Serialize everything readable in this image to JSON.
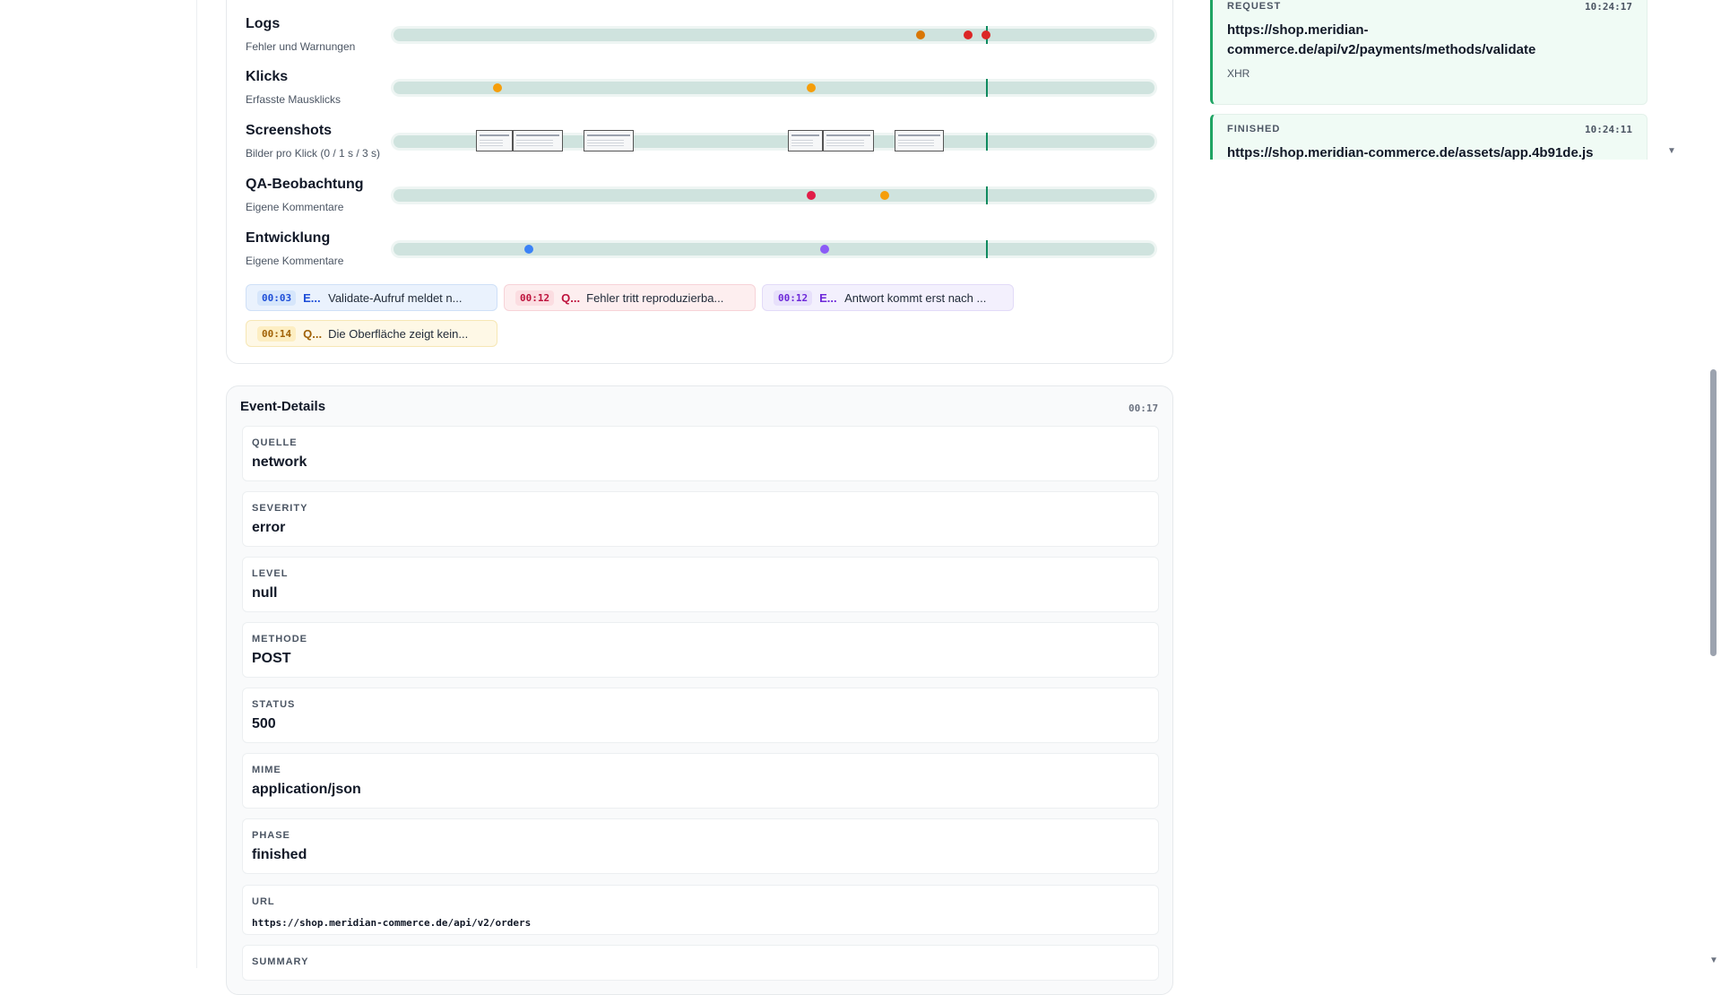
{
  "timeline": {
    "tracks": [
      {
        "title": "Logs",
        "subtitle": "Fehler und Warnungen",
        "dots": [
          {
            "pos": 0.693,
            "color": "#d97706"
          },
          {
            "pos": 0.755,
            "color": "#dc2626"
          },
          {
            "pos": 0.779,
            "color": "#dc2626"
          }
        ]
      },
      {
        "title": "Klicks",
        "subtitle": "Erfasste Mausklicks",
        "dots": [
          {
            "pos": 0.137,
            "color": "#f59e0b"
          },
          {
            "pos": 0.549,
            "color": "#f59e0b"
          }
        ]
      },
      {
        "title": "Screenshots",
        "subtitle": "Bilder pro Klick (0 / 1 s / 3 s)",
        "thumbs": [
          [
            0.108,
            0.157
          ],
          [
            0.157,
            0.223
          ],
          [
            0.25,
            0.316
          ],
          [
            0.518,
            0.564
          ],
          [
            0.564,
            0.631
          ],
          [
            0.658,
            0.723
          ]
        ]
      },
      {
        "title": "QA-Beobachtung",
        "subtitle": "Eigene Kommentare",
        "dots": [
          {
            "pos": 0.549,
            "color": "#e11d48"
          },
          {
            "pos": 0.645,
            "color": "#f59e0b"
          }
        ]
      },
      {
        "title": "Entwicklung",
        "subtitle": "Eigene Kommentare",
        "dots": [
          {
            "pos": 0.178,
            "color": "#3b82f6"
          },
          {
            "pos": 0.567,
            "color": "#8b5cf6"
          }
        ]
      }
    ],
    "cursor_pos": 0.778,
    "chips": [
      {
        "time": "00:03",
        "author": "E...",
        "text": "Validate-Aufruf meldet n...",
        "bg": "#eaf2fd",
        "border": "#cfe0f7",
        "ts_bg": "#d6e6fb",
        "ts_color": "#1d4ed8",
        "au_color": "#1d4ed8"
      },
      {
        "time": "00:12",
        "author": "Q...",
        "text": "Fehler tritt reproduzierba...",
        "bg": "#fdeeef",
        "border": "#f7d3d8",
        "ts_bg": "#fbdde1",
        "ts_color": "#be123c",
        "au_color": "#be123c"
      },
      {
        "time": "00:12",
        "author": "E...",
        "text": "Antwort kommt erst nach ...",
        "bg": "#f3f0fd",
        "border": "#e2dbf8",
        "ts_bg": "#e7e0fb",
        "ts_color": "#6d28d9",
        "au_color": "#6d28d9"
      },
      {
        "time": "00:14",
        "author": "Q...",
        "text": "Die Oberfläche zeigt kein...",
        "bg": "#fef8e6",
        "border": "#f6e7b5",
        "ts_bg": "#fdeec2",
        "ts_color": "#a16207",
        "au_color": "#a16207"
      }
    ]
  },
  "event_details": {
    "title": "Event-Details",
    "time": "00:17",
    "fields": [
      {
        "label": "QUELLE",
        "value": "network"
      },
      {
        "label": "SEVERITY",
        "value": "error"
      },
      {
        "label": "LEVEL",
        "value": "null"
      },
      {
        "label": "METHODE",
        "value": "POST"
      },
      {
        "label": "STATUS",
        "value": "500"
      },
      {
        "label": "MIME",
        "value": "application/json"
      },
      {
        "label": "PHASE",
        "value": "finished"
      },
      {
        "label": "URL",
        "value": "https://shop.meridian-commerce.de/api/v2/orders"
      },
      {
        "label": "SUMMARY",
        "value": ""
      }
    ]
  },
  "network": {
    "items": [
      {
        "kind": "REQUEST",
        "time": "10:24:17",
        "url": "https://shop.meridian-commerce.de/api/v2/payments/methods/validate",
        "type": "XHR"
      },
      {
        "kind": "FINISHED",
        "time": "10:24:11",
        "url": "https://shop.meridian-commerce.de/assets/app.4b91de.js",
        "type": ""
      }
    ]
  },
  "icons": {
    "scroll_up": "scroll-down-arrow",
    "scroll_down": "scroll-down-arrow"
  }
}
